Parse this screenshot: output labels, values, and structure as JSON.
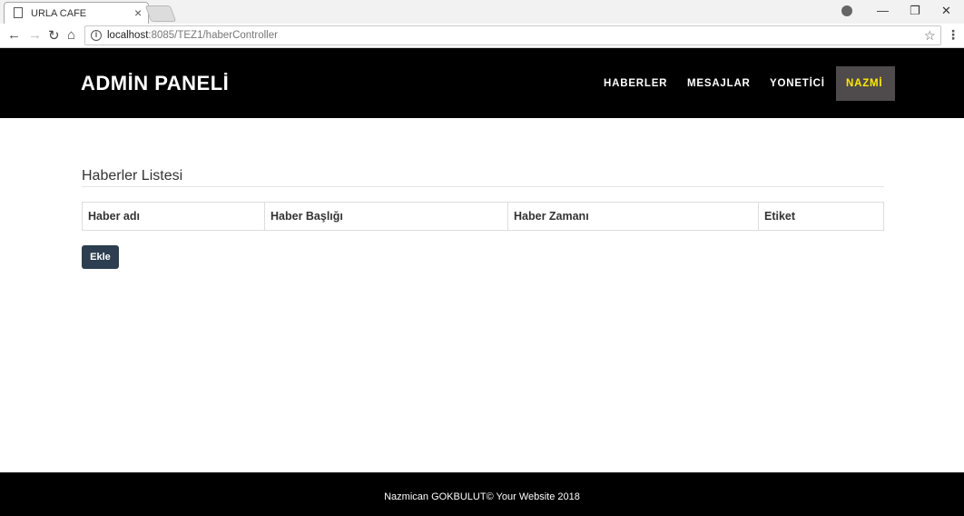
{
  "browser": {
    "tab_title": "URLA CAFE",
    "tab_close": "×",
    "url_host": "localhost",
    "url_path": ":8085/TEZ1/haberController",
    "icons": {
      "back": "arrow-left-icon",
      "forward": "arrow-right-icon",
      "reload": "reload-icon",
      "home": "home-icon",
      "info": "info-icon",
      "star": "star-icon",
      "menu": "kebab-menu-icon",
      "profile": "profile-icon"
    }
  },
  "navbar": {
    "brand": "ADMİN PANELİ",
    "items": [
      {
        "label": "HABERLER"
      },
      {
        "label": "MESAJLAR"
      },
      {
        "label": "YONETİCİ"
      }
    ],
    "active_item": "NAZMİ",
    "background": "#000000",
    "active_background": "#4f4a4b",
    "active_text_color": "#ffeb00"
  },
  "main": {
    "heading": "Haberler Listesi",
    "table": {
      "columns": [
        "Haber adı",
        "Haber Başlığı",
        "Haber Zamanı",
        "Etiket"
      ],
      "rows": []
    },
    "add_button": "Ekle",
    "add_button_color": "#2c3e50"
  },
  "footer": {
    "text": "Nazmican GOKBULUT© Your Website 2018"
  }
}
